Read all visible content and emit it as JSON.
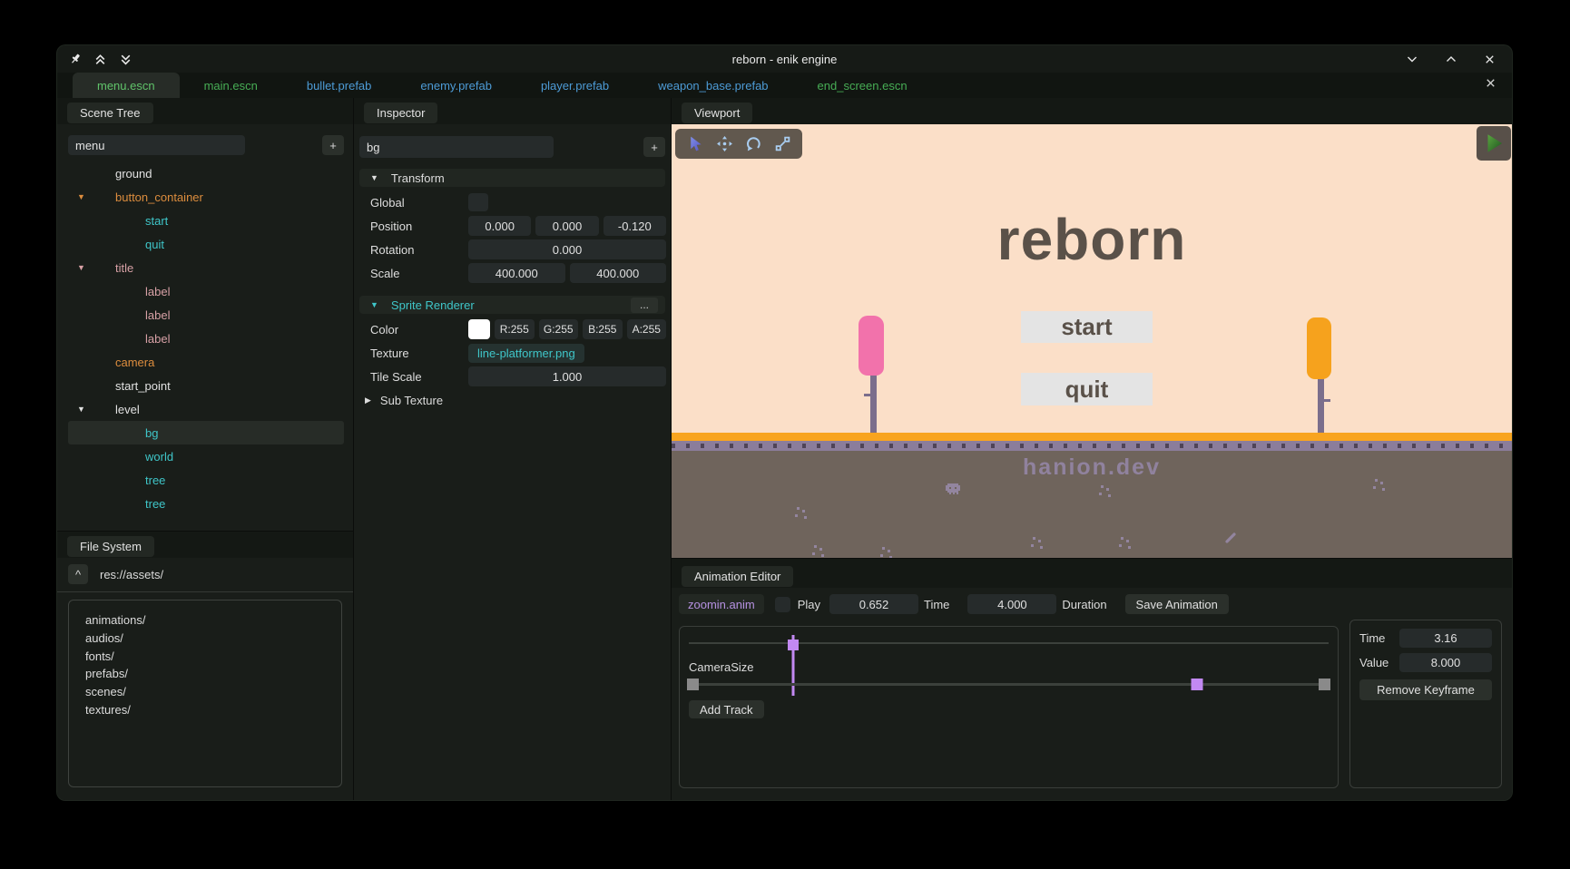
{
  "icons": {
    "collapse": "▼",
    "expand": "▶"
  },
  "window": {
    "title": "reborn - enik engine"
  },
  "file_tabs": [
    {
      "label": "menu.escn",
      "color": "#60c36a",
      "active": true
    },
    {
      "label": "main.escn",
      "color": "#47ad55",
      "active": false
    },
    {
      "label": "bullet.prefab",
      "color": "#4d9bd6",
      "active": false
    },
    {
      "label": "enemy.prefab",
      "color": "#4d9bd6",
      "active": false
    },
    {
      "label": "player.prefab",
      "color": "#4d9bd6",
      "active": false
    },
    {
      "label": "weapon_base.prefab",
      "color": "#4d9bd6",
      "active": false
    },
    {
      "label": "end_screen.escn",
      "color": "#47ad55",
      "active": false
    }
  ],
  "scene_tree": {
    "tab_label": "Scene Tree",
    "root_name": "menu",
    "add_button": "+",
    "items": [
      {
        "label": "ground",
        "indent": 1,
        "arrow": "",
        "color": "#e2e2e2",
        "selected": false
      },
      {
        "label": "button_container",
        "indent": 1,
        "arrow": "▼",
        "color": "#dd8d3e",
        "selected": false
      },
      {
        "label": "start",
        "indent": 2,
        "arrow": "",
        "color": "#3fc6c9",
        "selected": false
      },
      {
        "label": "quit",
        "indent": 2,
        "arrow": "",
        "color": "#3fc6c9",
        "selected": false
      },
      {
        "label": "title",
        "indent": 1,
        "arrow": "▼",
        "color": "#d8a1a6",
        "selected": false
      },
      {
        "label": "label",
        "indent": 2,
        "arrow": "",
        "color": "#d8a1a6",
        "selected": false
      },
      {
        "label": "label",
        "indent": 2,
        "arrow": "",
        "color": "#d8a1a6",
        "selected": false
      },
      {
        "label": "label",
        "indent": 2,
        "arrow": "",
        "color": "#d8a1a6",
        "selected": false
      },
      {
        "label": "camera",
        "indent": 1,
        "arrow": "",
        "color": "#dd8d3e",
        "selected": false
      },
      {
        "label": "start_point",
        "indent": 1,
        "arrow": "",
        "color": "#e2e2e2",
        "selected": false
      },
      {
        "label": "level",
        "indent": 1,
        "arrow": "▼",
        "color": "#e2e2e2",
        "selected": false
      },
      {
        "label": "bg",
        "indent": 2,
        "arrow": "",
        "color": "#3fc6c9",
        "selected": true
      },
      {
        "label": "world",
        "indent": 2,
        "arrow": "",
        "color": "#3fc6c9",
        "selected": false
      },
      {
        "label": "tree",
        "indent": 2,
        "arrow": "",
        "color": "#3fc6c9",
        "selected": false
      },
      {
        "label": "tree",
        "indent": 2,
        "arrow": "",
        "color": "#3fc6c9",
        "selected": false
      }
    ]
  },
  "file_system": {
    "tab_label": "File System",
    "up_button": "^",
    "path": "res://assets/",
    "entries": [
      "animations/",
      "audios/",
      "fonts/",
      "prefabs/",
      "scenes/",
      "textures/"
    ]
  },
  "inspector": {
    "tab_label": "Inspector",
    "node_name": "bg",
    "add_button": "+",
    "transform": {
      "header": "Transform",
      "global_label": "Global",
      "position_label": "Position",
      "position": [
        "0.000",
        "0.000",
        "-0.120"
      ],
      "rotation_label": "Rotation",
      "rotation": "0.000",
      "scale_label": "Scale",
      "scale": [
        "400.000",
        "400.000"
      ]
    },
    "sprite_renderer": {
      "header": "Sprite Renderer",
      "menu_button": "...",
      "color_label": "Color",
      "rgba": [
        "R:255",
        "G:255",
        "B:255",
        "A:255"
      ],
      "texture_label": "Texture",
      "texture": "line-platformer.png",
      "tile_scale_label": "Tile Scale",
      "tile_scale": "1.000",
      "sub_texture_label": "Sub Texture"
    }
  },
  "viewport": {
    "tab_label": "Viewport",
    "game": {
      "title": "reborn",
      "start_button": "start",
      "quit_button": "quit",
      "watermark": "hanion.dev",
      "sky_color": "#fbdfc8",
      "ground_color": "#f8a41f",
      "dirt_color": "#6f645c",
      "ink_color": "#5a5149"
    }
  },
  "animation_editor": {
    "tab_label": "Animation Editor",
    "anim_name": "zoomin.anim",
    "play_label": "Play",
    "time_value": "0.652",
    "time_label": "Time",
    "duration_value": "4.000",
    "duration_label": "Duration",
    "save_button": "Save Animation",
    "track_name": "CameraSize",
    "add_track_button": "Add Track",
    "playhead_left": "16.3%",
    "keyframe_left": "79.5%",
    "keyframe_color": "#c289f2",
    "keyframe_panel": {
      "time_label": "Time",
      "time_value": "3.16",
      "value_label": "Value",
      "value_value": "8.000",
      "remove_button": "Remove Keyframe"
    }
  }
}
